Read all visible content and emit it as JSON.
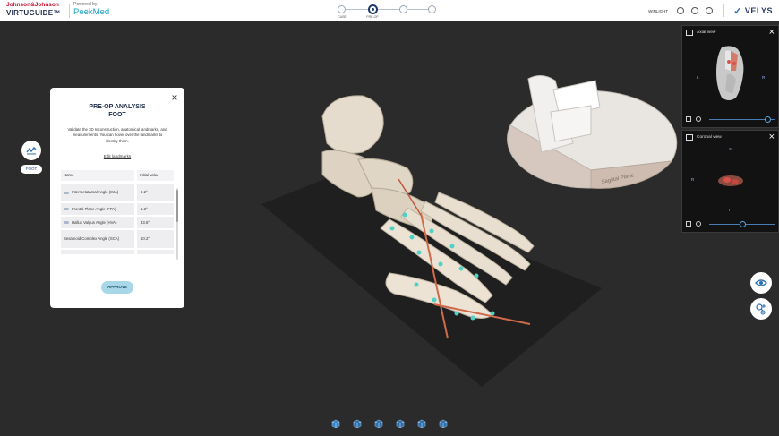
{
  "header": {
    "brand_company": "Johnson&Johnson",
    "brand_product": "VIRTUGUIDE™",
    "powered_by": "Powered by",
    "powered_brand": "PeekMed",
    "steps": [
      {
        "label": "CASE",
        "active": false
      },
      {
        "label": "PRE-OP",
        "active": true
      },
      {
        "label": "",
        "active": false
      },
      {
        "label": "",
        "active": false
      }
    ],
    "user_name": "WINLIGHT",
    "product_logo": "VELYS"
  },
  "left_nav": {
    "foot_label": "FOOT",
    "foot_icon": "foot-analysis-icon"
  },
  "panel": {
    "title_line1": "PRE-OP ANALYSIS",
    "title_line2": "FOOT",
    "description": "Validate the 3D reconstruction, anatomical landmarks, and measurements. You can hover over the landmarks to identify them.",
    "edit_link": "Edit landmarks",
    "table": {
      "col_name": "Name",
      "col_value": "Initial value",
      "rows": [
        {
          "name": "Intermetatarsal Angle (IMA)",
          "value": "9.2°",
          "has_pill": true
        },
        {
          "name": "Frontal Plane Angle (FPA)",
          "value": "1.3°",
          "has_pill": true
        },
        {
          "name": "Hallux Valgus Angle (HVA)",
          "value": "43.8°",
          "has_pill": true
        },
        {
          "name": "Sesamoid Complex Angle (SCA)",
          "value": "10.2°",
          "has_pill": false
        }
      ]
    },
    "approve_label": "APPROVE"
  },
  "scene": {
    "gauge_label": "Sagittal Plane"
  },
  "views": {
    "axial": {
      "title": "Axial view",
      "letter_l": "L",
      "letter_r": "R",
      "slider_value": 0.85
    },
    "coronal": {
      "title": "Coronal view",
      "letter_s": "S",
      "letter_r": "R",
      "letter_i": "I",
      "slider_value": 0.45
    }
  },
  "controls": {
    "visibility_icon": "eye-icon",
    "zoom_icon": "zoom-icon"
  },
  "bottom_toolbar": {
    "views": [
      "view-cube-front-icon",
      "view-cube-top-icon",
      "view-cube-left-icon",
      "view-cube-right-icon",
      "view-cube-bottom-icon",
      "view-cube-iso-icon"
    ]
  }
}
